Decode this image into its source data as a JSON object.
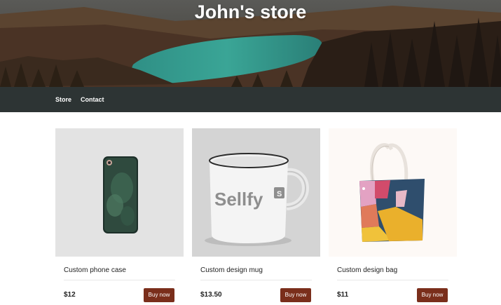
{
  "header": {
    "title": "John's store"
  },
  "nav": {
    "items": [
      "Store",
      "Contact"
    ]
  },
  "products": [
    {
      "name": "Custom phone case",
      "price": "$12",
      "button": "Buy now"
    },
    {
      "name": "Custom design mug",
      "price": "$13.50",
      "button": "Buy now",
      "logo_text": "Sellfy",
      "logo_badge": "S"
    },
    {
      "name": "Custom design bag",
      "price": "$11",
      "button": "Buy now"
    }
  ],
  "colors": {
    "navbar": "#2d3434",
    "button": "#7a2e1b",
    "lake": "#2f9a8c"
  }
}
